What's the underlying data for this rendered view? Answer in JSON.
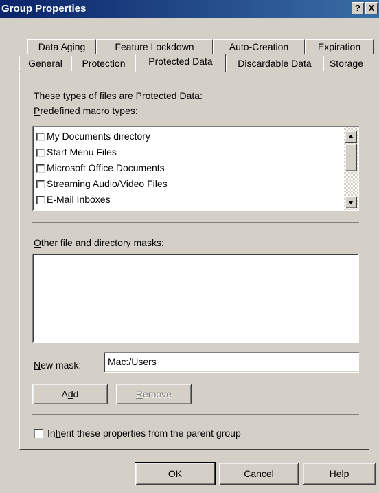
{
  "window": {
    "title": "Group Properties",
    "help_button": "?",
    "close_button": "X"
  },
  "tabs_row1": [
    "Data Aging",
    "Feature Lockdown",
    "Auto-Creation",
    "Expiration"
  ],
  "tabs_row2": [
    "General",
    "Protection",
    "Protected Data",
    "Discardable Data",
    "Storage"
  ],
  "active_tab": "Protected Data",
  "panel": {
    "intro": "These types of files are Protected Data:",
    "predefined_label_ul": "P",
    "predefined_label_rest": "redefined macro types:",
    "macro_types": [
      {
        "label": "My Documents directory",
        "checked": false
      },
      {
        "label": "Start Menu Files",
        "checked": false
      },
      {
        "label": "Microsoft Office Documents",
        "checked": false
      },
      {
        "label": "Streaming Audio/Video  Files",
        "checked": false
      },
      {
        "label": "E-Mail Inboxes",
        "checked": false
      }
    ],
    "other_label_ul": "O",
    "other_label_rest": "ther file and directory masks:",
    "new_mask_label_ul": "N",
    "new_mask_label_rest": "ew mask:",
    "new_mask_value": "Mac:/Users",
    "add_pre": "A",
    "add_ul": "d",
    "add_post": "d",
    "remove_ul": "R",
    "remove_rest": "emove",
    "inherit_pre": "In",
    "inherit_ul": "h",
    "inherit_post": "erit these properties from the parent group",
    "inherit_checked": false
  },
  "footer": {
    "ok": "OK",
    "cancel": "Cancel",
    "help": "Help"
  }
}
